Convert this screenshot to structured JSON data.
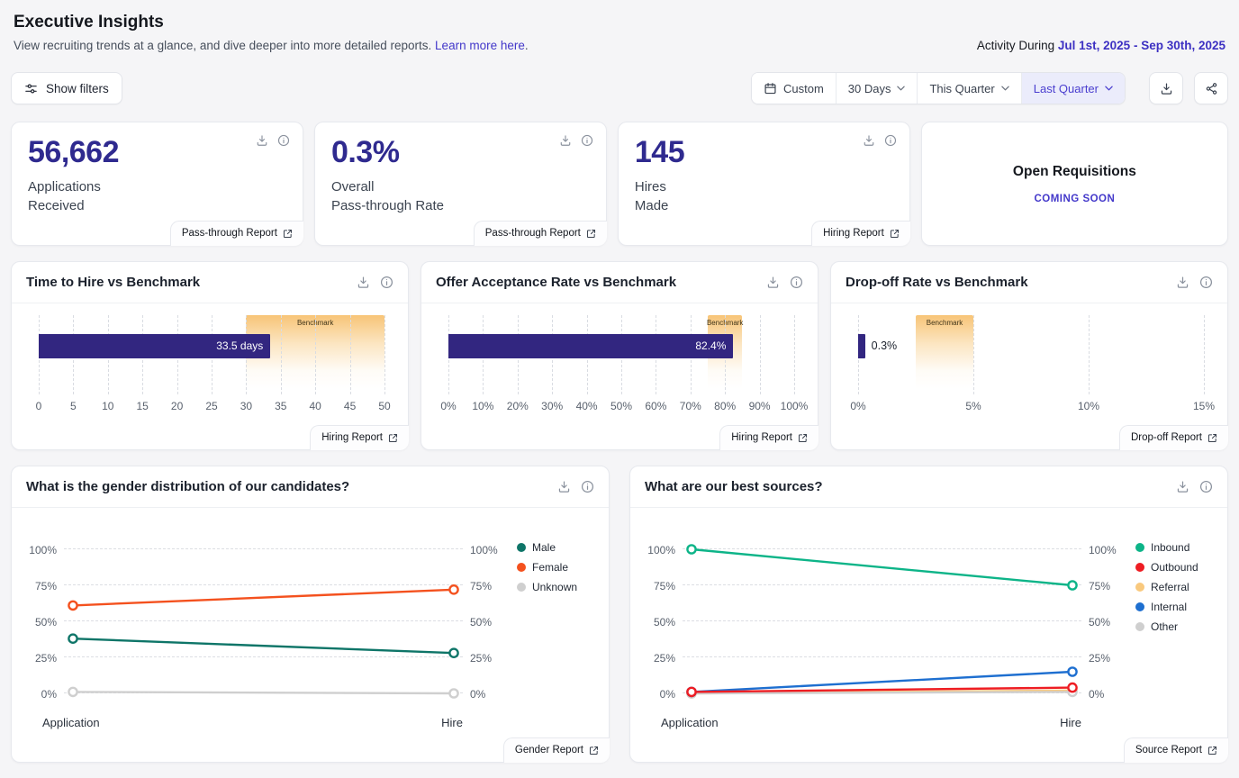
{
  "colors": {
    "accent": "#4338ca",
    "kpi_value": "#2f2a8f",
    "bar": "#322680",
    "benchmark_fill": "#f8c57a",
    "selected_filter_bg": "#ebecfb"
  },
  "header": {
    "title": "Executive Insights",
    "subtitle": "View recruiting trends at a glance, and dive deeper into more detailed reports.",
    "learn_more": "Learn more here",
    "period": ".",
    "activity_label": "Activity During",
    "activity_range": "Jul 1st, 2025 - Sep 30th, 2025"
  },
  "toolbar": {
    "show_filters": "Show filters",
    "custom": "Custom",
    "thirty_days": "30 Days",
    "this_quarter": "This Quarter",
    "last_quarter": "Last Quarter"
  },
  "kpis": [
    {
      "value": "56,662",
      "label1": "Applications",
      "label2": "Received",
      "report": "Pass-through Report"
    },
    {
      "value": "0.3%",
      "label1": "Overall",
      "label2": "Pass-through Rate",
      "report": "Pass-through Report"
    },
    {
      "value": "145",
      "label1": "Hires",
      "label2": "Made",
      "report": "Hiring Report"
    }
  ],
  "open_requisitions": {
    "title": "Open Requisitions",
    "status": "COMING SOON"
  },
  "chart_data": [
    {
      "type": "bar",
      "title": "Time to Hire vs Benchmark",
      "value": 33.5,
      "value_label": "33.5 days",
      "label_inside": true,
      "max": 50,
      "ticks": [
        0,
        5,
        10,
        15,
        20,
        25,
        30,
        35,
        40,
        45,
        50
      ],
      "tick_labels": [
        "0",
        "5",
        "10",
        "15",
        "20",
        "25",
        "30",
        "35",
        "40",
        "45",
        "50"
      ],
      "benchmark_label": "Benchmark",
      "benchmark_range": [
        30,
        50
      ],
      "bar_color": "#322680",
      "report": "Hiring Report"
    },
    {
      "type": "bar",
      "title": "Offer Acceptance Rate vs Benchmark",
      "value": 82.4,
      "value_label": "82.4%",
      "label_inside": true,
      "max": 100,
      "ticks": [
        0,
        10,
        20,
        30,
        40,
        50,
        60,
        70,
        80,
        90,
        100
      ],
      "tick_labels": [
        "0%",
        "10%",
        "20%",
        "30%",
        "40%",
        "50%",
        "60%",
        "70%",
        "80%",
        "90%",
        "100%"
      ],
      "benchmark_label": "Benchmark",
      "benchmark_range": [
        75,
        85
      ],
      "bar_color": "#322680",
      "report": "Hiring Report"
    },
    {
      "type": "bar",
      "title": "Drop-off Rate vs Benchmark",
      "value": 0.3,
      "value_label": "0.3%",
      "label_inside": false,
      "max": 15,
      "ticks": [
        0,
        5,
        10,
        15
      ],
      "tick_labels": [
        "0%",
        "5%",
        "10%",
        "15%"
      ],
      "benchmark_label": "Benchmark",
      "benchmark_range": [
        2.5,
        5
      ],
      "bar_color": "#322680",
      "report": "Drop-off Report"
    },
    {
      "type": "line",
      "title": "What is the gender distribution of our candidates?",
      "categories": [
        "Application",
        "Hire"
      ],
      "y_ticks": [
        0,
        25,
        50,
        75,
        100
      ],
      "series": [
        {
          "name": "Male",
          "color": "#0e7568",
          "values": [
            38,
            28
          ]
        },
        {
          "name": "Female",
          "color": "#f4511e",
          "values": [
            61,
            72
          ]
        },
        {
          "name": "Unknown",
          "color": "#cfcfcf",
          "values": [
            1,
            0
          ]
        }
      ],
      "draw_order": [
        2,
        0,
        1
      ],
      "report": "Gender Report"
    },
    {
      "type": "line",
      "title": "What are our best sources?",
      "categories": [
        "Application",
        "Hire"
      ],
      "y_ticks": [
        0,
        25,
        50,
        75,
        100
      ],
      "series": [
        {
          "name": "Inbound",
          "color": "#0db488",
          "values": [
            100,
            75
          ]
        },
        {
          "name": "Outbound",
          "color": "#ee1d23",
          "values": [
            1,
            4
          ]
        },
        {
          "name": "Referral",
          "color": "#f9c97e",
          "values": [
            0,
            2
          ]
        },
        {
          "name": "Internal",
          "color": "#1e6fd0",
          "values": [
            1,
            15
          ]
        },
        {
          "name": "Other",
          "color": "#cfcfcf",
          "values": [
            0,
            1
          ]
        }
      ],
      "draw_order": [
        0,
        2,
        4,
        3,
        1
      ],
      "report": "Source Report"
    }
  ]
}
